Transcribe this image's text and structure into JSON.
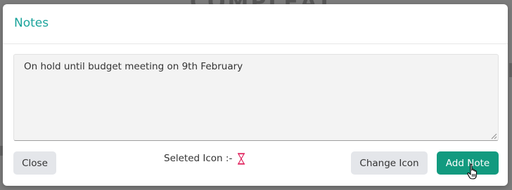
{
  "background": {
    "logo_text": "COMPLEAT"
  },
  "modal": {
    "title": "Notes",
    "note_text": "On hold until budget meeting on 9th February",
    "selected_icon_label": "Seleted Icon :-",
    "selected_icon": "hourglass-icon",
    "close_label": "Close",
    "change_icon_label": "Change Icon",
    "add_note_label": "Add Note"
  },
  "colors": {
    "title": "#1aa39b",
    "primary_button": "#129a7f",
    "secondary_button": "#e4e6ea",
    "icon_accent": "#e0245e",
    "textarea_bg": "#f3f3f3"
  }
}
